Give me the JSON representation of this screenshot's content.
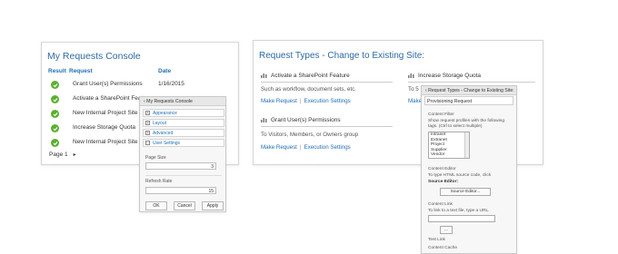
{
  "console": {
    "title": "My Requests Console",
    "col_result": "Result",
    "col_request": "Request",
    "col_date": "Date",
    "rows": [
      {
        "request": "Grant User(s) Permissions",
        "date": "1/16/2015"
      },
      {
        "request": "Activate a SharePoint Featu",
        "date": ""
      },
      {
        "request": "New Internal Project Site (",
        "date": ""
      },
      {
        "request": "Increase Storage Quota",
        "date": ""
      },
      {
        "request": "New Internal Project Site (",
        "date": ""
      }
    ],
    "pager": "Page 1",
    "pager_arrow": "▸"
  },
  "settings": {
    "title": "‹ My Requests Console",
    "sections": [
      {
        "toggle": "+",
        "label": "Appearance"
      },
      {
        "toggle": "+",
        "label": "Layout"
      },
      {
        "toggle": "+",
        "label": "Advanced"
      },
      {
        "toggle": "−",
        "label": "User Settings"
      }
    ],
    "page_size_label": "Page Size",
    "page_size_value": "3",
    "refresh_label": "Refresh Rate",
    "refresh_value": "15",
    "ok": "OK",
    "cancel": "Cancel",
    "apply": "Apply"
  },
  "types": {
    "title": "Request Types - Change to Existing Site:",
    "items": [
      {
        "title": "Activate a SharePoint Feature",
        "desc": "Such as workflow, document sets, etc.",
        "make": "Make Request",
        "exec": "Execution Settings"
      },
      {
        "title": "Increase Storage Quota",
        "desc": "To 5",
        "make": "Make Req",
        "exec": ""
      },
      {
        "title": "Grant User(s) Permissions",
        "desc": "To Visitors, Members, or Owners group",
        "make": "Make Request",
        "exec": "Execution Settings"
      }
    ]
  },
  "prov": {
    "title": "‹ Request Types - Change to Existing Site:",
    "subheader": "Provisioning Request",
    "filter_label": "Content Filter",
    "filter_desc1": "Show request profiles with the following",
    "filter_desc2": "tags. (Ctrl to select multiple)",
    "tags": [
      "Intranet",
      "Extranet",
      "Project",
      "Supplier",
      "Vendor"
    ],
    "editor_label": "Content Editor",
    "editor_desc": "To type HTML source code, click",
    "editor_bold": "Source Editor:",
    "editor_btn": "Source Editor...",
    "link_label": "Content Link",
    "link_desc": "To link to a text file, type a URL.",
    "link_btn": "...",
    "test_link": "Test Link",
    "cache_label": "Content Cache"
  },
  "colors": {
    "accent": "#1f6fb4",
    "check": "#5cb02f"
  }
}
